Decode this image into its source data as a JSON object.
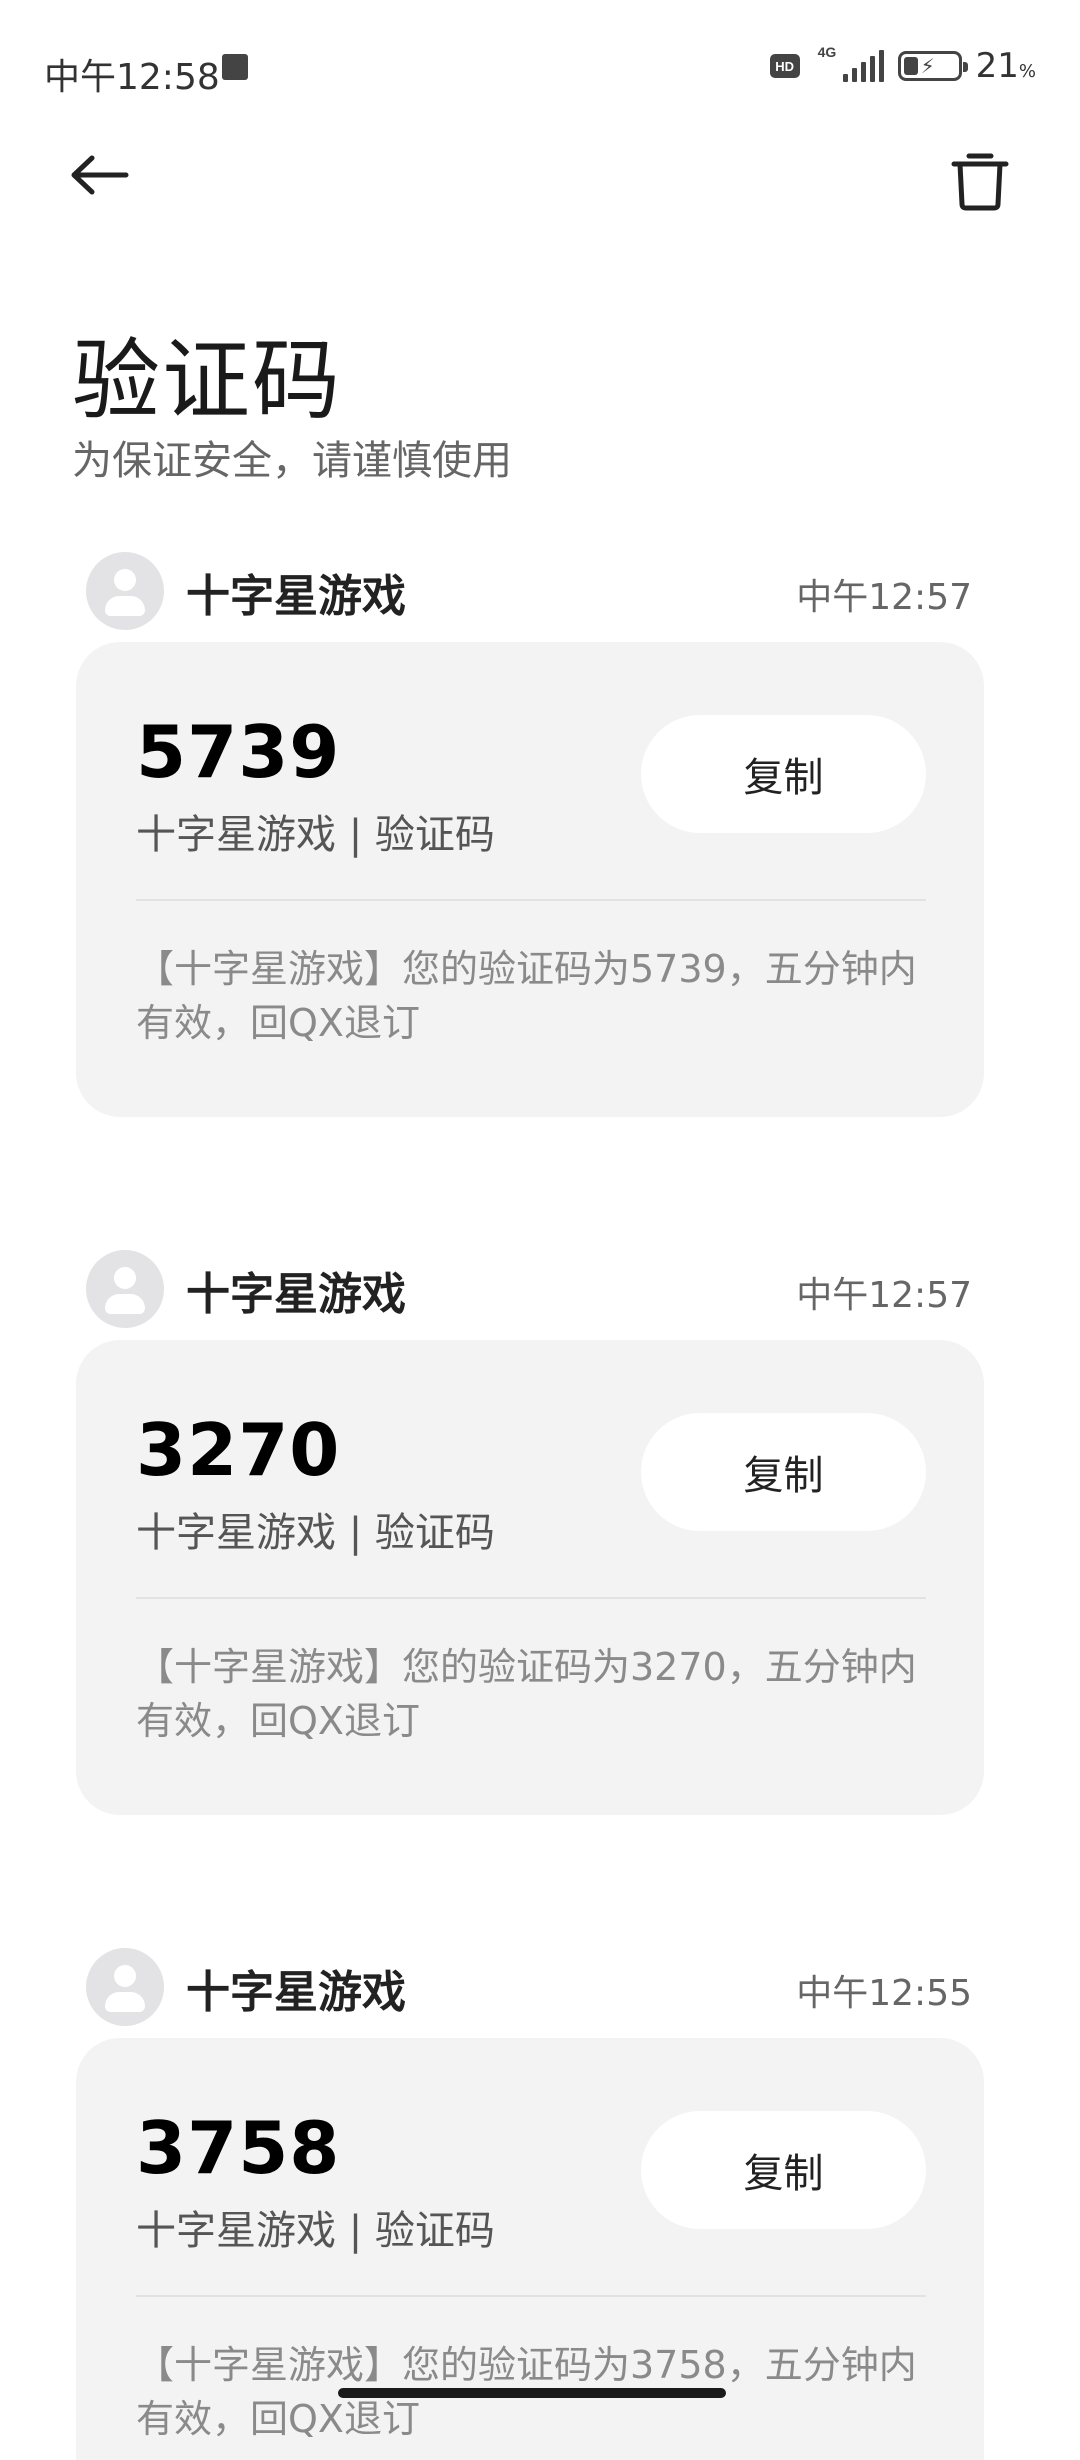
{
  "status_bar": {
    "time": "中午12:58",
    "hd": "HD",
    "network": "4G",
    "battery_pct": "21",
    "battery_unit": "%",
    "battery_level": 0.21
  },
  "nav": {
    "back_icon": "arrow-left-icon",
    "delete_icon": "trash-icon"
  },
  "header": {
    "title": "验证码",
    "subtitle": "为保证安全，请谨慎使用"
  },
  "messages": [
    {
      "sender": "十字星游戏",
      "time": "中午12:57",
      "code": "5739",
      "code_label": "十字星游戏 | 验证码",
      "copy_label": "复制",
      "body": "【十字星游戏】您的验证码为5739，五分钟内有效，回QX退订"
    },
    {
      "sender": "十字星游戏",
      "time": "中午12:57",
      "code": "3270",
      "code_label": "十字星游戏 | 验证码",
      "copy_label": "复制",
      "body": "【十字星游戏】您的验证码为3270，五分钟内有效，回QX退订"
    },
    {
      "sender": "十字星游戏",
      "time": "中午12:55",
      "code": "3758",
      "code_label": "十字星游戏 | 验证码",
      "copy_label": "复制",
      "body": "【十字星游戏】您的验证码为3758，五分钟内有效，回QX退订"
    }
  ]
}
